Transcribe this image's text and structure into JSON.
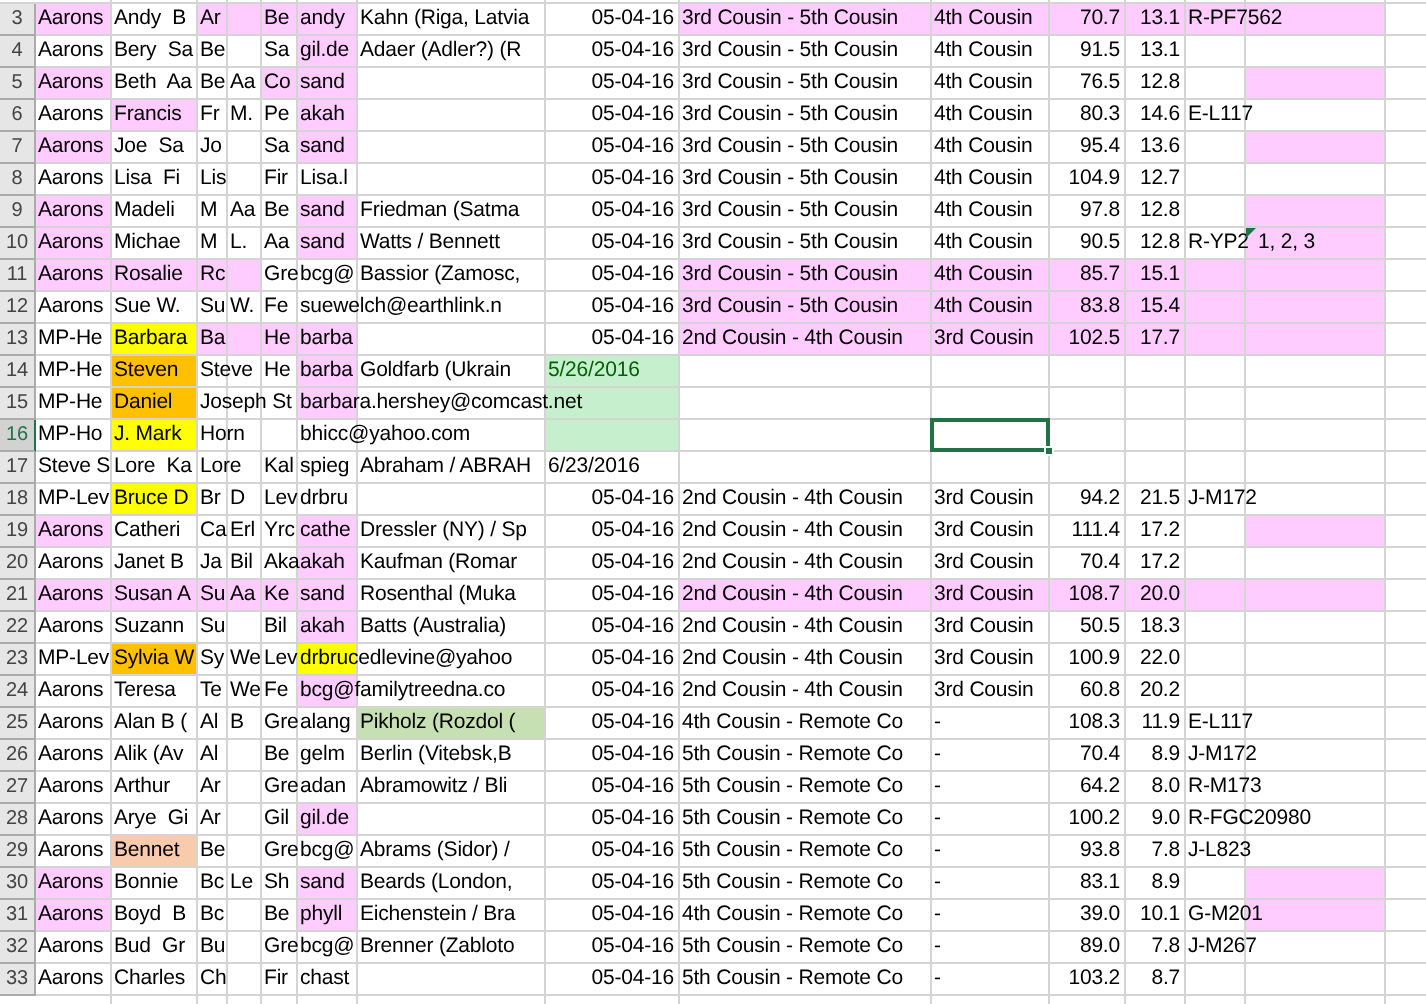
{
  "rows": [
    {
      "number": "3",
      "selected": false,
      "cells": [
        {
          "text": "Aarons",
          "color": "#ffccff"
        },
        {
          "text": "Andy  B"
        },
        {
          "text": "Ar",
          "color": "#ffccff"
        },
        {
          "color": "#ffccff"
        },
        {
          "text": "Be",
          "color": "#ffccff"
        },
        {
          "text": "andy",
          "color": "#ffccff"
        },
        {
          "text": "Kahn (Riga, Latvia"
        },
        {
          "text": "05-04-16"
        },
        {
          "text": "3rd Cousin - 5th Cousin",
          "color": "#ffccff"
        },
        {
          "text": "4th Cousin",
          "color": "#ffccff"
        },
        {
          "text": "70.7",
          "color": "#ffccff"
        },
        {
          "text": "13.1",
          "color": "#ffccff"
        },
        {
          "text": "R-PF7562",
          "color": "#ffccff"
        },
        {
          "color": "#ffccff"
        }
      ]
    },
    {
      "number": "4",
      "selected": false,
      "cells": [
        {
          "text": "Aarons"
        },
        {
          "text": "Bery  Sa"
        },
        {
          "text": "Be"
        },
        {},
        {
          "text": "Sa"
        },
        {
          "text": "gil.de",
          "color": "#ffccff"
        },
        {
          "text": "Adaer (Adler?) (R"
        },
        {
          "text": "05-04-16"
        },
        {
          "text": "3rd Cousin - 5th Cousin"
        },
        {
          "text": "4th Cousin"
        },
        {
          "text": "91.5"
        },
        {
          "text": "13.1"
        },
        {},
        {}
      ]
    },
    {
      "number": "5",
      "selected": false,
      "cells": [
        {
          "text": "Aarons",
          "color": "#ffccff"
        },
        {
          "text": "Beth  Aa"
        },
        {
          "text": "Be"
        },
        {
          "text": "Aa"
        },
        {
          "text": "Co",
          "color": "#ffccff"
        },
        {
          "text": "sand",
          "color": "#ffccff"
        },
        {},
        {
          "text": "05-04-16"
        },
        {
          "text": "3rd Cousin - 5th Cousin"
        },
        {
          "text": "4th Cousin"
        },
        {
          "text": "76.5"
        },
        {
          "text": "12.8"
        },
        {},
        {
          "color": "#ffccff"
        }
      ]
    },
    {
      "number": "6",
      "selected": false,
      "cells": [
        {
          "text": "Aarons"
        },
        {
          "text": "Francis",
          "color": "#ffccff"
        },
        {
          "text": "Fr"
        },
        {
          "text": "M."
        },
        {
          "text": "Pe"
        },
        {
          "text": "akah",
          "color": "#ffccff"
        },
        {},
        {
          "text": "05-04-16"
        },
        {
          "text": "3rd Cousin - 5th Cousin"
        },
        {
          "text": "4th Cousin"
        },
        {
          "text": "80.3"
        },
        {
          "text": "14.6"
        },
        {
          "text": "E-L117"
        },
        {}
      ]
    },
    {
      "number": "7",
      "selected": false,
      "cells": [
        {
          "text": "Aarons",
          "color": "#ffccff"
        },
        {
          "text": "Joe  Sa"
        },
        {
          "text": "Jo"
        },
        {},
        {
          "text": "Sa"
        },
        {
          "text": "sand",
          "color": "#ffccff"
        },
        {},
        {
          "text": "05-04-16"
        },
        {
          "text": "3rd Cousin - 5th Cousin"
        },
        {
          "text": "4th Cousin"
        },
        {
          "text": "95.4"
        },
        {
          "text": "13.6"
        },
        {},
        {
          "color": "#ffccff"
        }
      ]
    },
    {
      "number": "8",
      "selected": false,
      "cells": [
        {
          "text": "Aarons"
        },
        {
          "text": "Lisa  Fi"
        },
        {
          "text": "Lis"
        },
        {},
        {
          "text": "Fir"
        },
        {
          "text": "Lisa.l"
        },
        {},
        {
          "text": "05-04-16"
        },
        {
          "text": "3rd Cousin - 5th Cousin"
        },
        {
          "text": "4th Cousin"
        },
        {
          "text": "104.9"
        },
        {
          "text": "12.7"
        },
        {},
        {}
      ]
    },
    {
      "number": "9",
      "selected": false,
      "cells": [
        {
          "text": "Aarons",
          "color": "#ffccff"
        },
        {
          "text": "Madeli"
        },
        {
          "text": "M"
        },
        {
          "text": "Aa"
        },
        {
          "text": "Be"
        },
        {
          "text": "sand",
          "color": "#ffccff"
        },
        {
          "text": "Friedman (Satma"
        },
        {
          "text": "05-04-16"
        },
        {
          "text": "3rd Cousin - 5th Cousin"
        },
        {
          "text": "4th Cousin"
        },
        {
          "text": "97.8"
        },
        {
          "text": "12.8"
        },
        {},
        {
          "color": "#ffccff"
        }
      ]
    },
    {
      "number": "10",
      "selected": false,
      "cells": [
        {
          "text": "Aarons",
          "color": "#ffccff"
        },
        {
          "text": "Michae"
        },
        {
          "text": "M"
        },
        {
          "text": "L."
        },
        {
          "text": "Aa"
        },
        {
          "text": "sand",
          "color": "#ffccff"
        },
        {
          "text": "Watts / Bennett"
        },
        {
          "text": "05-04-16"
        },
        {
          "text": "3rd Cousin - 5th Cousin"
        },
        {
          "text": "4th Cousin"
        },
        {
          "text": "90.5"
        },
        {
          "text": "12.8"
        },
        {
          "text": "R-YP2"
        },
        {
          "text": "1, 2, 3",
          "color": "#ffccff",
          "comment": true
        }
      ]
    },
    {
      "number": "11",
      "selected": false,
      "cells": [
        {
          "text": "Aarons",
          "color": "#ffccff"
        },
        {
          "text": "Rosalie",
          "color": "#ffccff"
        },
        {
          "text": "Rc",
          "color": "#ffccff"
        },
        {
          "color": "#ffccff"
        },
        {
          "text": "Gre"
        },
        {
          "text": "bcg@"
        },
        {
          "text": "Bassior (Zamosc,"
        },
        {
          "text": "05-04-16"
        },
        {
          "text": "3rd Cousin - 5th Cousin",
          "color": "#ffccff"
        },
        {
          "text": "4th Cousin",
          "color": "#ffccff"
        },
        {
          "text": "85.7",
          "color": "#ffccff"
        },
        {
          "text": "15.1",
          "color": "#ffccff"
        },
        {
          "color": "#ffccff"
        },
        {
          "color": "#ffccff"
        }
      ]
    },
    {
      "number": "12",
      "selected": false,
      "cells": [
        {
          "text": "Aarons"
        },
        {
          "text": "Sue W."
        },
        {
          "text": "Su"
        },
        {
          "text": "W."
        },
        {
          "text": "Fe"
        },
        {
          "text": "suewelch@earthlink.n"
        },
        {},
        {
          "text": "05-04-16"
        },
        {
          "text": "3rd Cousin - 5th Cousin",
          "color": "#ffccff"
        },
        {
          "text": "4th Cousin",
          "color": "#ffccff"
        },
        {
          "text": "83.8",
          "color": "#ffccff"
        },
        {
          "text": "15.4",
          "color": "#ffccff"
        },
        {
          "color": "#ffccff"
        },
        {
          "color": "#ffccff"
        }
      ]
    },
    {
      "number": "13",
      "selected": false,
      "cells": [
        {
          "text": "MP-He"
        },
        {
          "text": "Barbara",
          "color": "#ffff00"
        },
        {
          "text": "Ba",
          "color": "#ffccff"
        },
        {
          "color": "#ffccff"
        },
        {
          "text": "He",
          "color": "#ffccff"
        },
        {
          "text": "barba",
          "color": "#ffccff"
        },
        {},
        {
          "text": "05-04-16"
        },
        {
          "text": "2nd Cousin - 4th Cousin",
          "color": "#ffccff"
        },
        {
          "text": "3rd Cousin",
          "color": "#ffccff"
        },
        {
          "text": "102.5",
          "color": "#ffccff"
        },
        {
          "text": "17.7",
          "color": "#ffccff"
        },
        {
          "color": "#ffccff"
        },
        {
          "color": "#ffccff"
        }
      ]
    },
    {
      "number": "14",
      "selected": false,
      "cells": [
        {
          "text": "MP-He"
        },
        {
          "text": "Steven",
          "color": "#ffc000"
        },
        {
          "text": "Steve"
        },
        {},
        {
          "text": "He"
        },
        {
          "text": "barba",
          "color": "#ffccff"
        },
        {
          "text": "Goldfarb (Ukrain"
        },
        {
          "text": "5/26/2016",
          "color": "#c6efce",
          "kind": "text"
        },
        {},
        {},
        {},
        {},
        {},
        {}
      ]
    },
    {
      "number": "15",
      "selected": false,
      "cells": [
        {
          "text": "MP-He"
        },
        {
          "text": "Daniel",
          "color": "#ffc000"
        },
        {
          "text": "Joseph St"
        },
        {},
        {},
        {
          "text": "barbara.hershey@comcast.net",
          "color": "#ffccff"
        },
        {},
        {
          "color": "#c6efce"
        },
        {},
        {},
        {},
        {},
        {},
        {}
      ]
    },
    {
      "number": "16",
      "selected": true,
      "cells": [
        {
          "text": "MP-Ho"
        },
        {
          "text": "J. Mark",
          "color": "#ffff00"
        },
        {
          "text": "Horn"
        },
        {},
        {},
        {
          "text": "bhicc@yahoo.com"
        },
        {},
        {
          "color": "#c6efce"
        },
        {},
        {},
        {},
        {},
        {},
        {}
      ]
    },
    {
      "number": "17",
      "selected": false,
      "cells": [
        {
          "text": "Steve S"
        },
        {
          "text": "Lore  Ka"
        },
        {
          "text": "Lore"
        },
        {},
        {
          "text": "Kal"
        },
        {
          "text": "spieg"
        },
        {
          "text": "Abraham / ABRAH"
        },
        {
          "text": "6/23/2016",
          "kind": "text"
        },
        {},
        {},
        {},
        {},
        {},
        {}
      ]
    },
    {
      "number": "18",
      "selected": false,
      "cells": [
        {
          "text": "MP-Lev"
        },
        {
          "text": "Bruce D",
          "color": "#ffff00"
        },
        {
          "text": "Br"
        },
        {
          "text": "D"
        },
        {
          "text": "Lev"
        },
        {
          "text": "drbru"
        },
        {},
        {
          "text": "05-04-16"
        },
        {
          "text": "2nd Cousin - 4th Cousin"
        },
        {
          "text": "3rd Cousin"
        },
        {
          "text": "94.2"
        },
        {
          "text": "21.5"
        },
        {
          "text": "J-M172"
        },
        {}
      ]
    },
    {
      "number": "19",
      "selected": false,
      "cells": [
        {
          "text": "Aarons",
          "color": "#ffccff"
        },
        {
          "text": "Catheri"
        },
        {
          "text": "Ca"
        },
        {
          "text": "Erl"
        },
        {
          "text": "Yrc"
        },
        {
          "text": "cathe",
          "color": "#ffccff"
        },
        {
          "text": "Dressler (NY) / Sp"
        },
        {
          "text": "05-04-16"
        },
        {
          "text": "2nd Cousin - 4th Cousin"
        },
        {
          "text": "3rd Cousin"
        },
        {
          "text": "111.4"
        },
        {
          "text": "17.2"
        },
        {},
        {
          "color": "#ffccff"
        }
      ]
    },
    {
      "number": "20",
      "selected": false,
      "cells": [
        {
          "text": "Aarons"
        },
        {
          "text": "Janet B"
        },
        {
          "text": "Ja"
        },
        {
          "text": "Bil"
        },
        {
          "text": "Aka"
        },
        {
          "text": "akah",
          "color": "#ffccff"
        },
        {
          "text": "Kaufman (Romar"
        },
        {
          "text": "05-04-16"
        },
        {
          "text": "2nd Cousin - 4th Cousin"
        },
        {
          "text": "3rd Cousin"
        },
        {
          "text": "70.4"
        },
        {
          "text": "17.2"
        },
        {},
        {}
      ]
    },
    {
      "number": "21",
      "selected": false,
      "cells": [
        {
          "text": "Aarons",
          "color": "#ffccff"
        },
        {
          "text": "Susan A",
          "color": "#ffccff"
        },
        {
          "text": "Su",
          "color": "#ffccff"
        },
        {
          "text": "Aa",
          "color": "#ffccff"
        },
        {
          "text": "Ke",
          "color": "#ffccff"
        },
        {
          "text": "sand",
          "color": "#ffccff"
        },
        {
          "text": "Rosenthal (Muka"
        },
        {
          "text": "05-04-16"
        },
        {
          "text": "2nd Cousin - 4th Cousin",
          "color": "#ffccff"
        },
        {
          "text": "3rd Cousin",
          "color": "#ffccff"
        },
        {
          "text": "108.7",
          "color": "#ffccff"
        },
        {
          "text": "20.0",
          "color": "#ffccff"
        },
        {
          "color": "#ffccff"
        },
        {
          "color": "#ffccff"
        }
      ]
    },
    {
      "number": "22",
      "selected": false,
      "cells": [
        {
          "text": "Aarons"
        },
        {
          "text": "Suzann"
        },
        {
          "text": "Su"
        },
        {},
        {
          "text": "Bil"
        },
        {
          "text": "akah",
          "color": "#ffccff"
        },
        {
          "text": "Batts (Australia)"
        },
        {
          "text": "05-04-16"
        },
        {
          "text": "2nd Cousin - 4th Cousin"
        },
        {
          "text": "3rd Cousin"
        },
        {
          "text": "50.5"
        },
        {
          "text": "18.3"
        },
        {},
        {}
      ]
    },
    {
      "number": "23",
      "selected": false,
      "cells": [
        {
          "text": "MP-Lev"
        },
        {
          "text": "Sylvia W",
          "color": "#ffc000"
        },
        {
          "text": "Sy"
        },
        {
          "text": "We"
        },
        {
          "text": "Lev"
        },
        {
          "text": "drbrucedlevine@yahoo",
          "color": "#ffff00"
        },
        {},
        {
          "text": "05-04-16"
        },
        {
          "text": "2nd Cousin - 4th Cousin"
        },
        {
          "text": "3rd Cousin"
        },
        {
          "text": "100.9"
        },
        {
          "text": "22.0"
        },
        {},
        {}
      ]
    },
    {
      "number": "24",
      "selected": false,
      "cells": [
        {
          "text": "Aarons"
        },
        {
          "text": "Teresa"
        },
        {
          "text": "Te"
        },
        {
          "text": "We"
        },
        {
          "text": "Fe"
        },
        {
          "text": "bcg@familytreedna.co",
          "color": "#ffccff"
        },
        {},
        {
          "text": "05-04-16"
        },
        {
          "text": "2nd Cousin - 4th Cousin"
        },
        {
          "text": "3rd Cousin"
        },
        {
          "text": "60.8"
        },
        {
          "text": "20.2"
        },
        {},
        {}
      ]
    },
    {
      "number": "25",
      "selected": false,
      "cells": [
        {
          "text": "Aarons"
        },
        {
          "text": "Alan B ("
        },
        {
          "text": "Al"
        },
        {
          "text": "B"
        },
        {
          "text": "Gre"
        },
        {
          "text": "alang"
        },
        {
          "text": "Pikholz (Rozdol (",
          "color": "#c6e0b4"
        },
        {
          "text": "05-04-16"
        },
        {
          "text": "4th Cousin - Remote Co"
        },
        {
          "text": "-"
        },
        {
          "text": "108.3"
        },
        {
          "text": "11.9"
        },
        {
          "text": "E-L117"
        },
        {}
      ]
    },
    {
      "number": "26",
      "selected": false,
      "cells": [
        {
          "text": "Aarons"
        },
        {
          "text": "Alik (Av"
        },
        {
          "text": "Al"
        },
        {},
        {
          "text": "Be"
        },
        {
          "text": "gelm"
        },
        {
          "text": "Berlin (Vitebsk,B"
        },
        {
          "text": "05-04-16"
        },
        {
          "text": "5th Cousin - Remote Co"
        },
        {
          "text": "-"
        },
        {
          "text": "70.4"
        },
        {
          "text": "8.9"
        },
        {
          "text": "J-M172"
        },
        {}
      ]
    },
    {
      "number": "27",
      "selected": false,
      "cells": [
        {
          "text": "Aarons"
        },
        {
          "text": "Arthur"
        },
        {
          "text": "Ar"
        },
        {},
        {
          "text": "Gre"
        },
        {
          "text": "adan"
        },
        {
          "text": "Abramowitz / Bli"
        },
        {
          "text": "05-04-16"
        },
        {
          "text": "5th Cousin - Remote Co"
        },
        {
          "text": "-"
        },
        {
          "text": "64.2"
        },
        {
          "text": "8.0"
        },
        {
          "text": "R-M173"
        },
        {}
      ]
    },
    {
      "number": "28",
      "selected": false,
      "cells": [
        {
          "text": "Aarons"
        },
        {
          "text": "Arye  Gi"
        },
        {
          "text": "Ar"
        },
        {},
        {
          "text": "Gil"
        },
        {
          "text": "gil.de",
          "color": "#ffccff"
        },
        {},
        {
          "text": "05-04-16"
        },
        {
          "text": "5th Cousin - Remote Co"
        },
        {
          "text": "-"
        },
        {
          "text": "100.2"
        },
        {
          "text": "9.0"
        },
        {
          "text": "R-FGC20980"
        },
        {}
      ]
    },
    {
      "number": "29",
      "selected": false,
      "cells": [
        {
          "text": "Aarons"
        },
        {
          "text": "Bennet",
          "color": "#f8cbad"
        },
        {
          "text": "Be"
        },
        {},
        {
          "text": "Gre"
        },
        {
          "text": "bcg@"
        },
        {
          "text": "Abrams (Sidor) /"
        },
        {
          "text": "05-04-16"
        },
        {
          "text": "5th Cousin - Remote Co"
        },
        {
          "text": "-"
        },
        {
          "text": "93.8"
        },
        {
          "text": "7.8"
        },
        {
          "text": "J-L823"
        },
        {}
      ]
    },
    {
      "number": "30",
      "selected": false,
      "cells": [
        {
          "text": "Aarons",
          "color": "#ffccff"
        },
        {
          "text": "Bonnie"
        },
        {
          "text": "Bc"
        },
        {
          "text": "Le"
        },
        {
          "text": "Sh"
        },
        {
          "text": "sand",
          "color": "#ffccff"
        },
        {
          "text": "Beards (London,"
        },
        {
          "text": "05-04-16"
        },
        {
          "text": "5th Cousin - Remote Co"
        },
        {
          "text": "-"
        },
        {
          "text": "83.1"
        },
        {
          "text": "8.9"
        },
        {},
        {
          "color": "#ffccff"
        }
      ]
    },
    {
      "number": "31",
      "selected": false,
      "cells": [
        {
          "text": "Aarons",
          "color": "#ffccff"
        },
        {
          "text": "Boyd  B"
        },
        {
          "text": "Bc"
        },
        {},
        {
          "text": "Be"
        },
        {
          "text": "phyll",
          "color": "#ffccff"
        },
        {
          "text": "Eichenstein / Bra"
        },
        {
          "text": "05-04-16"
        },
        {
          "text": "4th Cousin - Remote Co"
        },
        {
          "text": "-"
        },
        {
          "text": "39.0"
        },
        {
          "text": "10.1"
        },
        {
          "text": "G-M201"
        },
        {
          "color": "#ffccff"
        }
      ]
    },
    {
      "number": "32",
      "selected": false,
      "cells": [
        {
          "text": "Aarons"
        },
        {
          "text": "Bud  Gr"
        },
        {
          "text": "Bu"
        },
        {},
        {
          "text": "Gre"
        },
        {
          "text": "bcg@"
        },
        {
          "text": "Brenner (Zabloto"
        },
        {
          "text": "05-04-16"
        },
        {
          "text": "5th Cousin - Remote Co"
        },
        {
          "text": "-"
        },
        {
          "text": "89.0"
        },
        {
          "text": "7.8"
        },
        {
          "text": "J-M267"
        },
        {}
      ]
    },
    {
      "number": "33",
      "selected": false,
      "cells": [
        {
          "text": "Aarons"
        },
        {
          "text": "Charles"
        },
        {
          "text": "Ch"
        },
        {},
        {
          "text": "Fir"
        },
        {
          "text": "chast"
        },
        {},
        {
          "text": "05-04-16"
        },
        {
          "text": "5th Cousin - Remote Co"
        },
        {
          "text": "-"
        },
        {
          "text": "103.2"
        },
        {
          "text": "8.7"
        },
        {},
        {}
      ]
    }
  ]
}
